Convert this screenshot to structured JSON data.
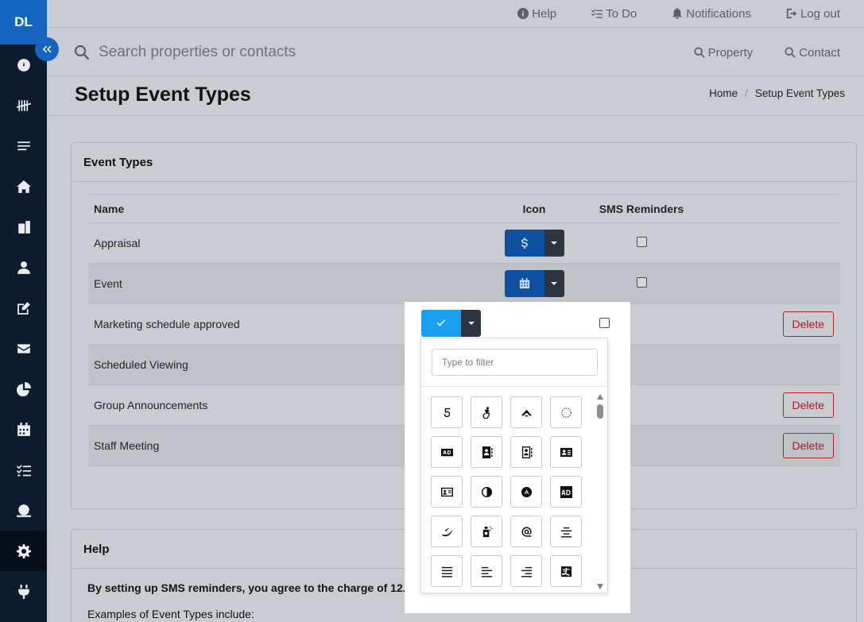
{
  "sidebar": {
    "logo": "DL",
    "items": [
      {
        "icon": "dashboard-icon"
      },
      {
        "icon": "tally-icon"
      },
      {
        "icon": "list-icon"
      },
      {
        "icon": "home-icon"
      },
      {
        "icon": "building-icon"
      },
      {
        "icon": "person-icon"
      },
      {
        "icon": "edit-icon"
      },
      {
        "icon": "envelope-icon"
      },
      {
        "icon": "pie-chart-icon"
      },
      {
        "icon": "calendar-icon"
      },
      {
        "icon": "tasks-icon"
      },
      {
        "icon": "money-icon"
      },
      {
        "icon": "gear-icon",
        "active": true
      },
      {
        "icon": "plug-icon"
      }
    ]
  },
  "topbar": {
    "help": "Help",
    "todo": "To Do",
    "notifications": "Notifications",
    "logout": "Log out"
  },
  "search": {
    "placeholder": "Search properties or contacts",
    "property": "Property",
    "contact": "Contact"
  },
  "page": {
    "title": "Setup Event Types",
    "breadcrumb": {
      "home": "Home",
      "current": "Setup Event Types"
    }
  },
  "event_types": {
    "heading": "Event Types",
    "columns": {
      "name": "Name",
      "icon": "Icon",
      "sms": "SMS Reminders"
    },
    "rows": [
      {
        "name": "Appraisal",
        "icon": "dollar-icon",
        "sms": false,
        "deletable": false
      },
      {
        "name": "Event",
        "icon": "calendar-icon",
        "sms": false,
        "deletable": false
      },
      {
        "name": "Marketing schedule approved",
        "icon": "check-icon",
        "sms": false,
        "deletable": true
      },
      {
        "name": "Scheduled Viewing",
        "icon": "",
        "sms": false,
        "deletable": false
      },
      {
        "name": "Group Announcements",
        "icon": "",
        "sms": false,
        "deletable": true
      },
      {
        "name": "Staff Meeting",
        "icon": "",
        "sms": false,
        "deletable": true
      }
    ],
    "delete_label": "Delete"
  },
  "icon_picker": {
    "filter_placeholder": "Type to filter",
    "icons": [
      "500px-icon",
      "accessible-icon",
      "accusoft-icon",
      "circle-notch-icon",
      "ad-icon",
      "address-book-icon",
      "address-book-outline-icon",
      "address-card-icon",
      "address-card-outline-icon",
      "adjust-icon",
      "adn-icon",
      "adversal-icon",
      "affiliatetheme-icon",
      "air-freshener-icon",
      "algolia-icon",
      "align-center-icon",
      "align-justify-icon",
      "align-left-icon",
      "align-right-icon",
      "alipay-icon"
    ]
  },
  "help": {
    "heading": "Help",
    "sms_note": "By setting up SMS reminders, you agree to the charge of 12.1 cents",
    "examples": "Examples of Event Types include:"
  },
  "colors": {
    "sidebar": "#0d1b2e",
    "accent": "#1565c0",
    "active_icon": "#1aa0f0",
    "danger": "#a31d25"
  }
}
